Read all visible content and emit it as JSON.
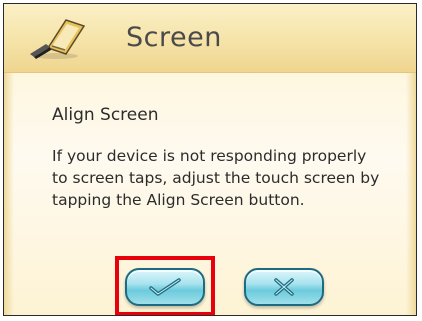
{
  "header": {
    "title": "Screen",
    "icon": "screen-settings-icon"
  },
  "content": {
    "heading": "Align Screen",
    "description": "If your device is not responding properly to screen taps, adjust the touch screen by tapping the Align Screen button."
  },
  "buttons": {
    "confirm_icon": "checkmark-icon",
    "cancel_icon": "x-icon"
  },
  "colors": {
    "highlight": "#e8000b",
    "button_accent": "#6ccadc",
    "background": "#fdf6dd"
  }
}
